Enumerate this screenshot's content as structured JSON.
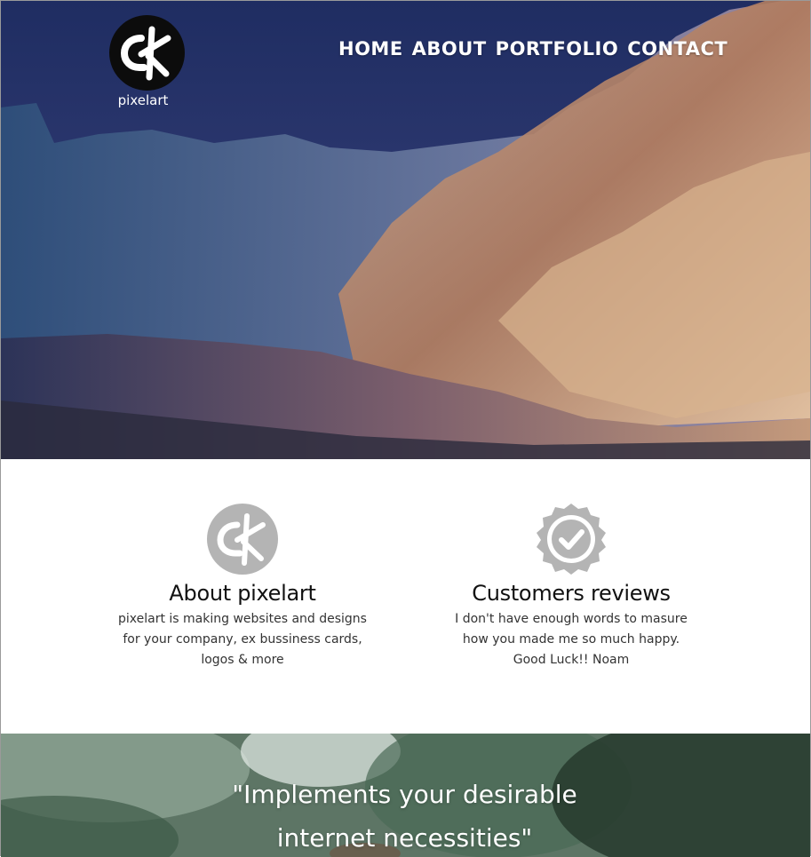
{
  "brand": {
    "name": "pixelart",
    "logo_icon": "pixelart-logo-icon"
  },
  "nav": {
    "items": [
      "HOME",
      "ABOUT",
      "PORTFOLIO",
      "CONTACT"
    ]
  },
  "features": [
    {
      "icon": "pixelart-logo-icon",
      "title": "About pixelart",
      "lines": [
        "pixelart is making websites and designs",
        "for your company, ex bussiness cards,",
        "logos & more"
      ]
    },
    {
      "icon": "check-badge-icon",
      "title": "Customers reviews",
      "lines": [
        "I don't have enough words to masure",
        "how you made me so much happy.",
        "Good Luck!! Noam"
      ]
    }
  ],
  "quote": {
    "lines": [
      "\"Implements your desirable",
      "internet necessities\""
    ]
  },
  "colors": {
    "logo_bg": "#0c0c0c",
    "feature_icon": "#b4b4b4",
    "nav_text": "#ffffff"
  }
}
